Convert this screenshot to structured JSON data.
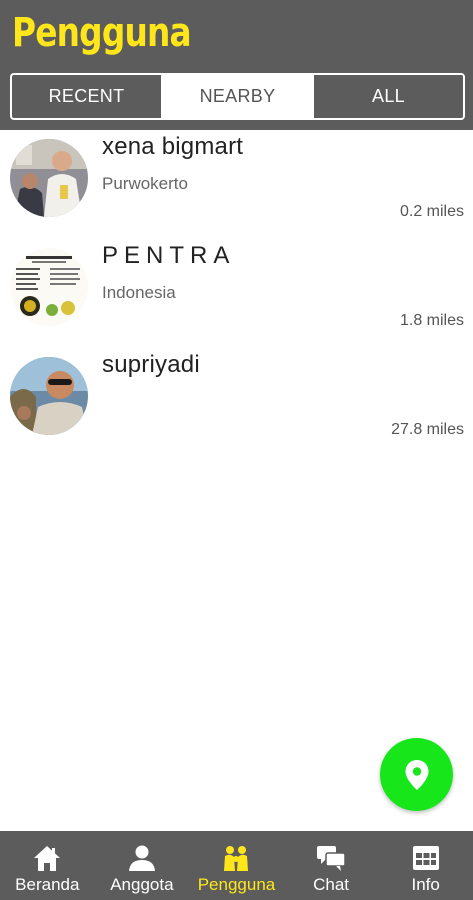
{
  "header": {
    "title": "Pengguna",
    "title_color": "#ffe61a",
    "background": "#5c5c5c"
  },
  "tabs": [
    {
      "label": "RECENT",
      "active": false
    },
    {
      "label": "NEARBY",
      "active": true
    },
    {
      "label": "ALL",
      "active": false
    }
  ],
  "users": [
    {
      "name": "xena bigmart",
      "location": "Purwokerto",
      "distance": "0.2 miles",
      "avatar": "photo-avatar"
    },
    {
      "name": "PENTRA",
      "location": "Indonesia",
      "distance": "1.8 miles",
      "avatar": "document-avatar"
    },
    {
      "name": "supriyadi",
      "location": "",
      "distance": "27.8 miles",
      "avatar": "photo-avatar"
    }
  ],
  "fab": {
    "icon": "location-pin-icon",
    "color": "#16e61a"
  },
  "bottom_nav": [
    {
      "label": "Beranda",
      "icon": "home-icon",
      "active": false
    },
    {
      "label": "Anggota",
      "icon": "person-icon",
      "active": false
    },
    {
      "label": "Pengguna",
      "icon": "users-icon",
      "active": true
    },
    {
      "label": "Chat",
      "icon": "chat-icon",
      "active": false
    },
    {
      "label": "Info",
      "icon": "info-table-icon",
      "active": false
    }
  ]
}
